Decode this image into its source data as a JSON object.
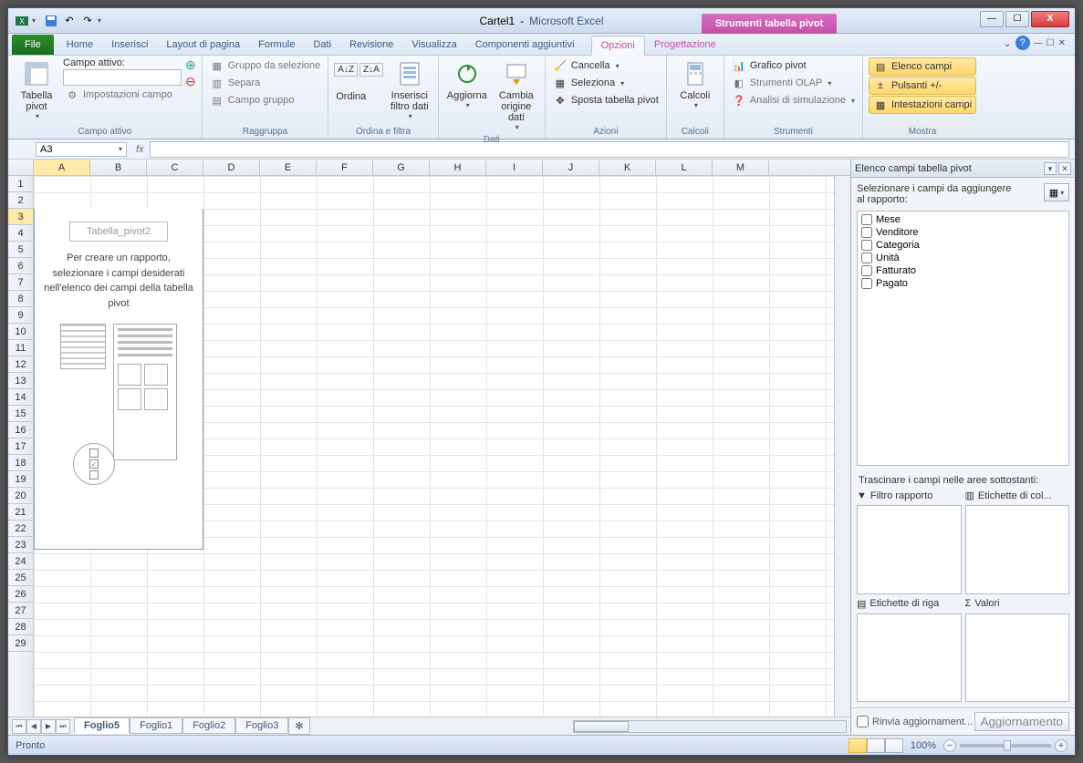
{
  "titlebar": {
    "document": "Cartel1",
    "separator": "-",
    "app": "Microsoft Excel",
    "context_title": "Strumenti tabella pivot"
  },
  "tabs": {
    "file": "File",
    "items": [
      "Home",
      "Inserisci",
      "Layout di pagina",
      "Formule",
      "Dati",
      "Revisione",
      "Visualizza",
      "Componenti aggiuntivi"
    ],
    "context_items": [
      "Opzioni",
      "Progettazione"
    ],
    "active_context": "Opzioni"
  },
  "ribbon": {
    "groups": {
      "campo_attivo": {
        "label": "Campo attivo",
        "pivot_btn": "Tabella pivot",
        "field_label": "Campo attivo:",
        "settings": "Impostazioni campo"
      },
      "raggruppa": {
        "label": "Raggruppa",
        "sel": "Gruppo da selezione",
        "sep": "Separa",
        "grp": "Campo gruppo"
      },
      "ordina_filtra": {
        "label": "Ordina e filtra",
        "sort": "Ordina",
        "slicer": "Inserisci filtro dati"
      },
      "dati": {
        "label": "Dati",
        "refresh": "Aggiorna",
        "change": "Cambia origine dati"
      },
      "azioni": {
        "label": "Azioni",
        "clear": "Cancella",
        "select": "Seleziona",
        "move": "Sposta tabella pivot"
      },
      "calcoli": {
        "label": "Calcoli",
        "btn": "Calcoli"
      },
      "strumenti": {
        "label": "Strumenti",
        "chart": "Grafico pivot",
        "olap": "Strumenti OLAP",
        "whatif": "Analisi di simulazione"
      },
      "mostra": {
        "label": "Mostra",
        "fieldlist": "Elenco campi",
        "buttons": "Pulsanti +/-",
        "headers": "Intestazioni campi"
      }
    }
  },
  "formula_bar": {
    "name_box": "A3",
    "fx": "fx"
  },
  "columns": [
    "A",
    "B",
    "C",
    "D",
    "E",
    "F",
    "G",
    "H",
    "I",
    "J",
    "K",
    "L",
    "M"
  ],
  "rows": [
    1,
    2,
    3,
    4,
    5,
    6,
    7,
    8,
    9,
    10,
    11,
    12,
    13,
    14,
    15,
    16,
    17,
    18,
    19,
    20,
    21,
    22,
    23,
    24,
    25,
    26,
    27,
    28,
    29
  ],
  "pivot_placeholder": {
    "name": "Tabella_pivot2",
    "instruction": "Per creare un rapporto, selezionare i campi desiderati nell'elenco dei campi della tabella pivot"
  },
  "sheet_tabs": {
    "active": "Foglio5",
    "tabs": [
      "Foglio5",
      "Foglio1",
      "Foglio2",
      "Foglio3"
    ]
  },
  "taskpane": {
    "title": "Elenco campi tabella pivot",
    "choose_text": "Selezionare i campi da aggiungere al rapporto:",
    "fields": [
      "Mese",
      "Venditore",
      "Categoria",
      "Unità",
      "Fatturato",
      "Pagato"
    ],
    "drag_text": "Trascinare i campi nelle aree sottostanti:",
    "areas": {
      "filter": "Filtro rapporto",
      "col": "Etichette di col...",
      "row": "Etichette di riga",
      "val": "Valori"
    },
    "defer": "Rinvia aggiornament...",
    "update": "Aggiornamento"
  },
  "statusbar": {
    "ready": "Pronto",
    "zoom": "100%"
  }
}
